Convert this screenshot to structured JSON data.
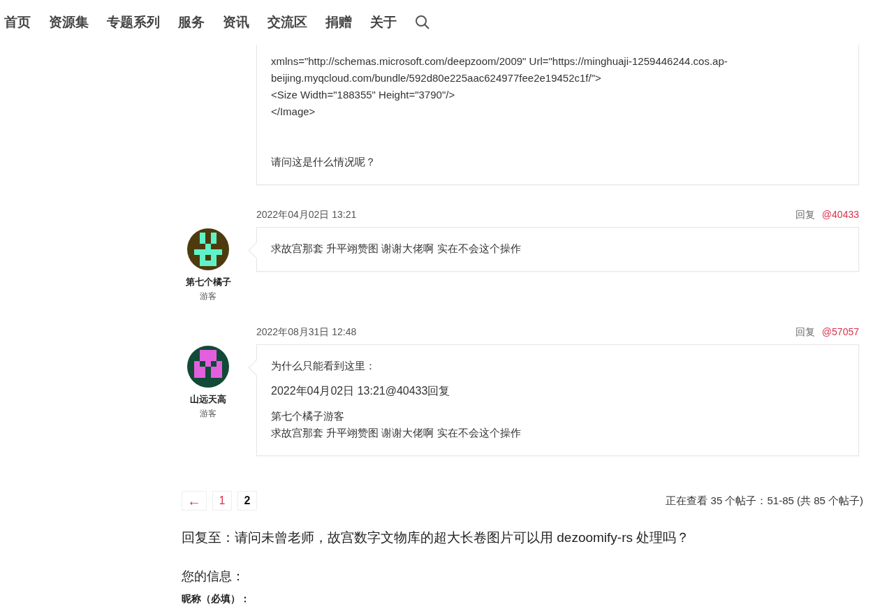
{
  "nav": {
    "items": [
      {
        "label": "首页"
      },
      {
        "label": "资源集"
      },
      {
        "label": "专题系列"
      },
      {
        "label": "服务"
      },
      {
        "label": "资讯"
      },
      {
        "label": "交流区"
      },
      {
        "label": "捐赠"
      },
      {
        "label": "关于"
      }
    ]
  },
  "first_post": {
    "code_lines": [
      "xmlns=\"http://schemas.microsoft.com/deepzoom/2009\" Url=\"https://minghuaji-1259446244.cos.ap-beijing.myqcloud.com/bundle/592d80e225aac624977fee2e19452c1f/\">",
      "<Size Width=\"188355\" Height=\"3790\"/>",
      "</Image>"
    ],
    "question": "请问这是什么情况呢？"
  },
  "replies": [
    {
      "date": "2022年04月02日 13:21",
      "reply_label": "回复",
      "reply_id": "@40433",
      "author": "第七个橘子",
      "role": "游客",
      "avatar": {
        "color": "#4d3b0e",
        "pattern": {
          "color": "#5ff2c8"
        }
      },
      "paragraphs": [
        [
          "求故宫那套 升平翊赞图 谢谢大佬啊 实在不会这个操作"
        ]
      ]
    },
    {
      "date": "2022年08月31日 12:48",
      "reply_label": "回复",
      "reply_id": "@57057",
      "author": "山远天高",
      "role": "游客",
      "avatar": {
        "color": "#114a36",
        "pattern": {
          "color": "#e35fde"
        }
      },
      "paragraphs": [
        [
          "为什么只能看到这里："
        ],
        [
          "2022年04月02日 13:21@40433回复"
        ],
        [
          "第七个橘子游客",
          "求故宫那套 升平翊赞图 谢谢大佬啊 实在不会这个操作"
        ]
      ]
    }
  ],
  "pagination": {
    "prev": "←",
    "pages": [
      {
        "label": "1",
        "selected": false
      },
      {
        "label": "2",
        "selected": true
      }
    ],
    "status": "正在查看 35 个帖子：51-85 (共 85 个帖子)"
  },
  "reply_heading": "回复至：请问未曾老师，故宫数字文物库的超大长卷图片可以用 dezoomify-rs 处理吗？",
  "info_heading": "您的信息：",
  "nickname_label": "昵称（必填）："
}
